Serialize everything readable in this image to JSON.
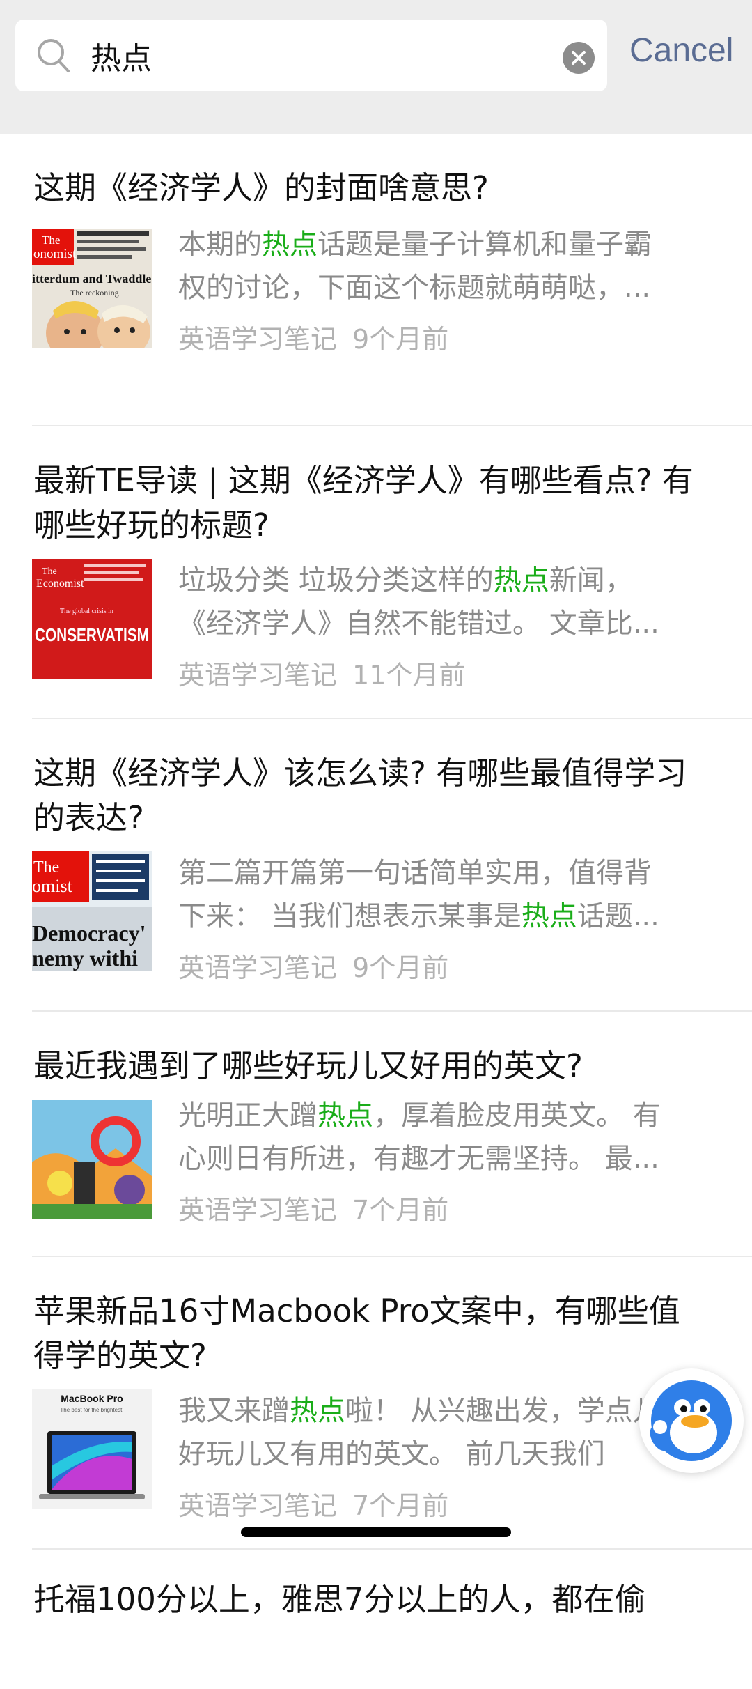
{
  "search": {
    "query": "热点",
    "cancel_label": "Cancel"
  },
  "results": [
    {
      "title": "这期《经济学人》的封面啥意思?",
      "snippet_line1": [
        "本期的",
        "热点",
        "话题是量子计算机和量子霸"
      ],
      "snippet_line2": "权的讨论，下面这个标题就萌萌哒，...",
      "source": "英语学习笔记",
      "time": "9个月前",
      "thumb": {
        "kind": "economist-cartoon",
        "logo_line1": "The",
        "logo_line2": "onomist",
        "headline": "itterdum and Twaddled",
        "sub": "The reckoning"
      }
    },
    {
      "title": "最新TE导读 | 这期《经济学人》有哪些看点? 有哪些好玩的标题?",
      "snippet_line1": [
        "垃圾分类 垃圾分类这样的",
        "热点",
        "新闻，"
      ],
      "snippet_line2": "《经济学人》自然不能错过。 文章比...",
      "source": "英语学习笔记",
      "time": "11个月前",
      "thumb": {
        "kind": "economist-red",
        "logo_line1": "The",
        "logo_line2": "Economist",
        "headline": "CONSERVATISM",
        "sub": "The global crisis in"
      }
    },
    {
      "title": "这期《经济学人》该怎么读? 有哪些最值得学习的表达?",
      "snippet_line1": [
        "第二篇开篇第一句话简单实用，值得背",
        "",
        ""
      ],
      "snippet_line2_parts": [
        "下来： 当我们想表示某事是",
        "热点",
        "话题..."
      ],
      "source": "英语学习笔记",
      "time": "9个月前",
      "thumb": {
        "kind": "economist-democracy",
        "logo_line1": "The",
        "logo_line2": "omist",
        "headline": "Democracy'",
        "sub": "nemy withi"
      }
    },
    {
      "title": "最近我遇到了哪些好玩儿又好用的英文?",
      "snippet_line1": [
        "光明正大蹭",
        "热点",
        "，厚着脸皮用英文。 有"
      ],
      "snippet_line2": "心则日有所进，有趣才无需坚持。 最...",
      "source": "英语学习笔记",
      "time": "7个月前",
      "thumb": {
        "kind": "game-art"
      }
    },
    {
      "title": "苹果新品16寸Macbook Pro文案中，有哪些值得学的英文?",
      "snippet_line1": [
        "我又来蹭",
        "热点",
        "啦！ 从兴趣出发，学点儿"
      ],
      "snippet_line2": "好玩儿又有用的英文。 前几天我们",
      "source": "英语学习笔记",
      "time": "7个月前",
      "thumb": {
        "kind": "macbook",
        "logo_line1": "MacBook Pro",
        "logo_line2": "The best for the brightest."
      }
    },
    {
      "title": "托福100分以上，雅思7分以上的人，都在偷",
      "partial": true
    }
  ],
  "colors": {
    "highlight": "#1aad19",
    "cancel": "#5a6c93",
    "header_bg": "#ededed"
  }
}
